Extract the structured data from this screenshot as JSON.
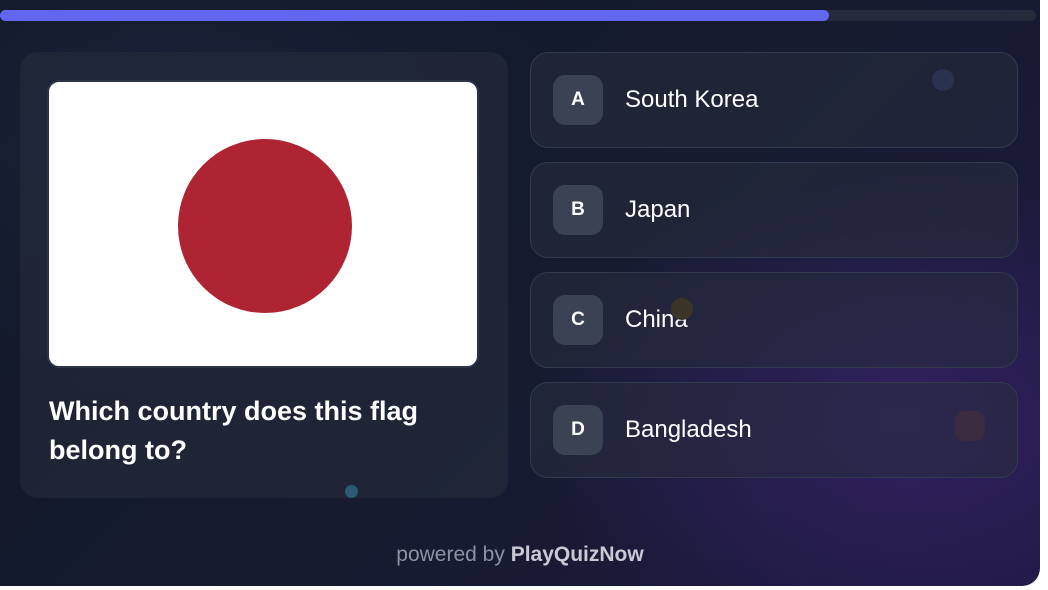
{
  "progress": {
    "fraction": 0.8,
    "color": "#6366f1"
  },
  "question": {
    "text": "Which country does this flag belong to?",
    "flag": {
      "name": "Japan",
      "field_color": "#ffffff",
      "disc_color": "#ae2433"
    }
  },
  "answers": [
    {
      "letter": "A",
      "label": "South Korea"
    },
    {
      "letter": "B",
      "label": "Japan"
    },
    {
      "letter": "C",
      "label": "China"
    },
    {
      "letter": "D",
      "label": "Bangladesh"
    }
  ],
  "footer": {
    "prefix": "powered by",
    "brand": "PlayQuizNow"
  },
  "colors": {
    "background": "#141a2c",
    "card": "#222838",
    "accent": "#6366f1"
  }
}
